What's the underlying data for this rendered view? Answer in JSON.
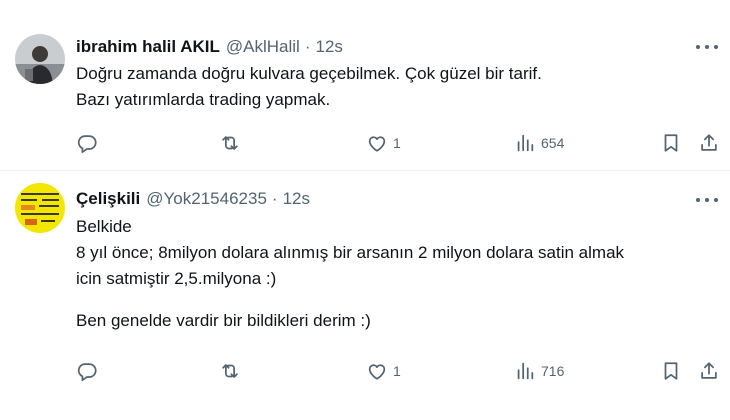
{
  "tweets": [
    {
      "author_name": "ibrahim halil AKIL",
      "handle": "@AklHalil",
      "separator": "·",
      "time": "12s",
      "lines": [
        "Doğru zamanda doğru kulvara geçebilmek. Çok güzel bir tarif.",
        "Bazı yatırımlarda trading yapmak."
      ],
      "likes": "1",
      "views": "654",
      "avatar_icon": "user-photo"
    },
    {
      "author_name": "Çelişkili",
      "handle": "@Yok21546235",
      "separator": "·",
      "time": "12s",
      "lines": [
        "Belkide",
        "8 yıl önce; 8milyon dolara alınmış bir arsanın 2 milyon dolara satin almak",
        "icin satmiştir 2,5.milyona :)",
        "Ben genelde vardir bir bildikleri derim :)"
      ],
      "likes": "1",
      "views": "716",
      "avatar_icon": "yellow-chart-image"
    }
  ],
  "icons": {
    "reply": "reply-icon",
    "retweet": "retweet-icon",
    "like": "heart-icon",
    "views": "views-icon",
    "bookmark": "bookmark-icon",
    "share": "share-icon",
    "more": "more-icon"
  },
  "colors": {
    "text": "#0f1419",
    "secondary": "#536471",
    "divider": "#eff3f4"
  }
}
